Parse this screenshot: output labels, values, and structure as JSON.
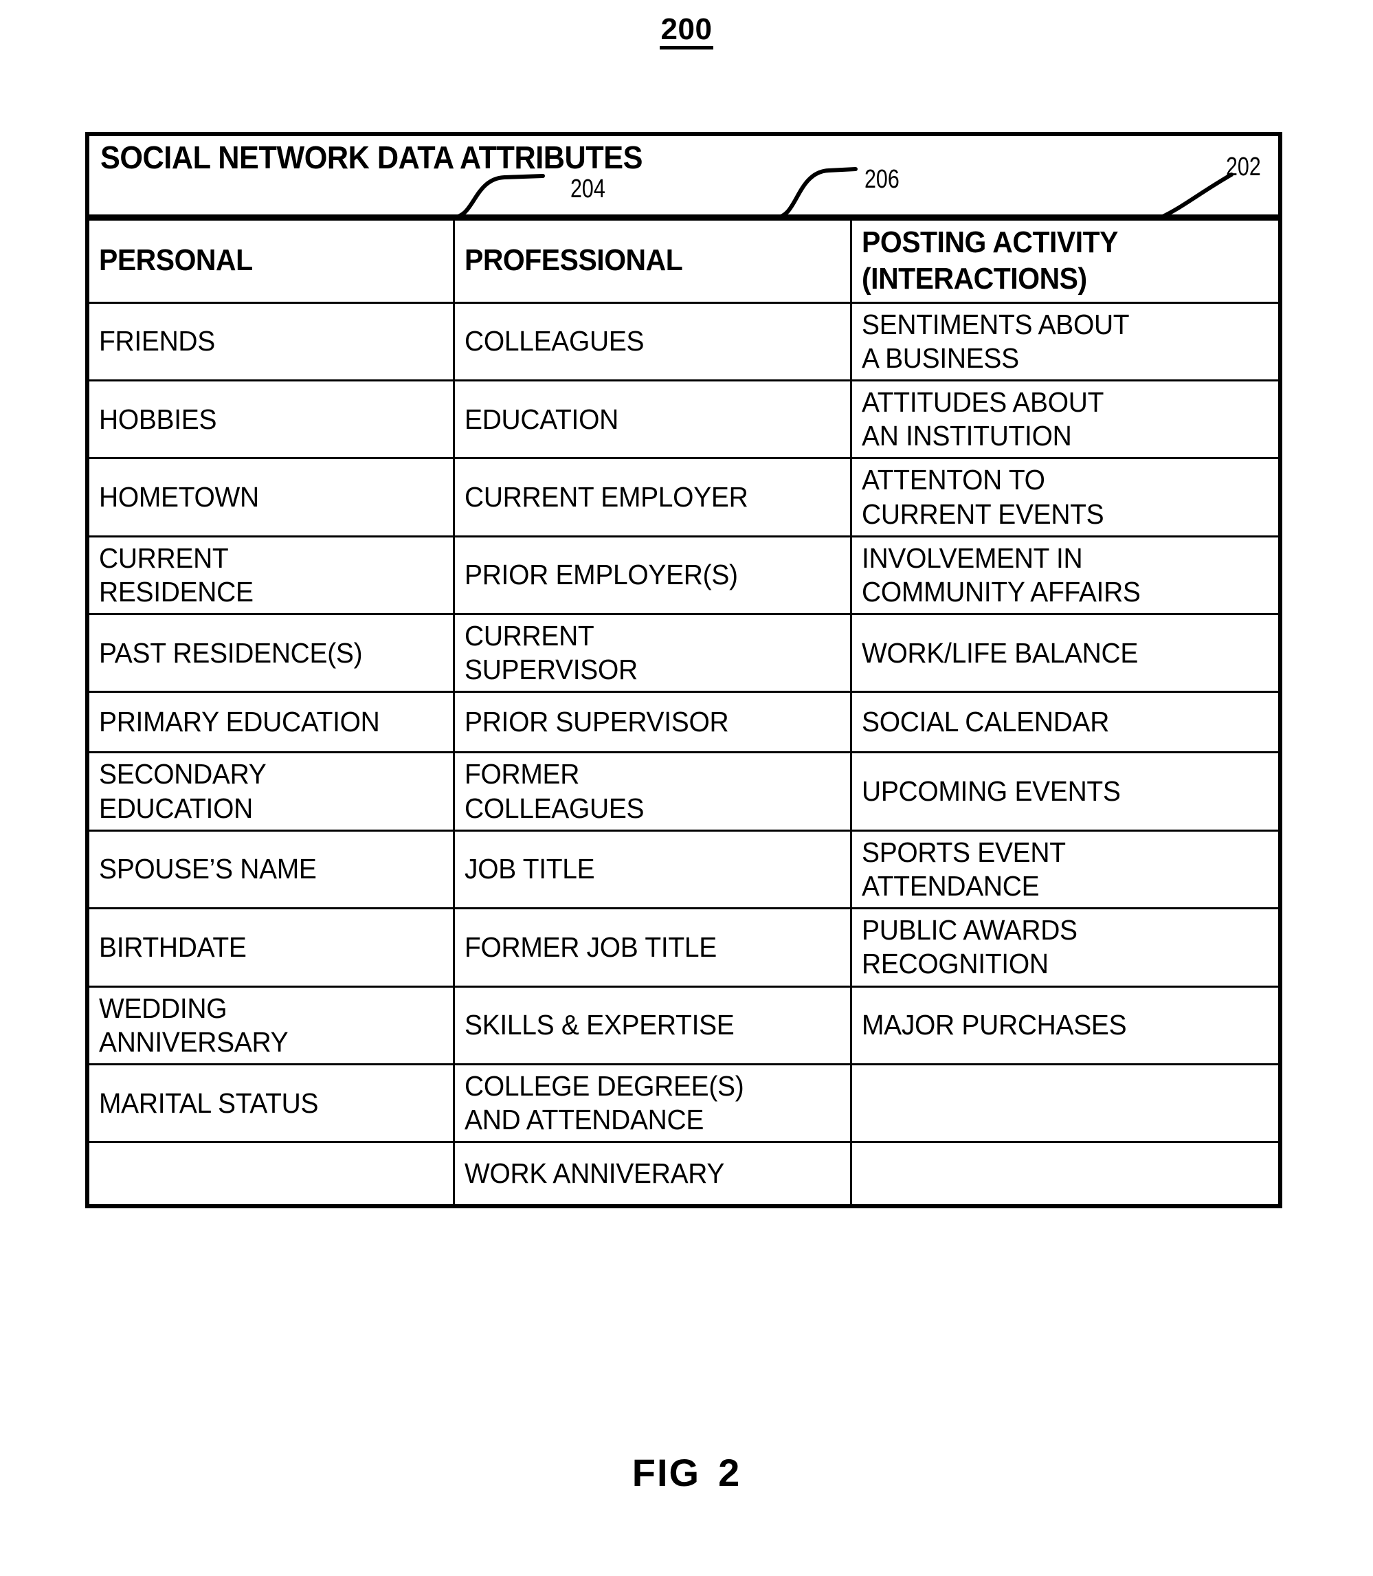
{
  "figure": {
    "top_number": "200",
    "bottom_label_prefix": "FIG",
    "bottom_label_number": "2"
  },
  "table": {
    "banner_title": "SOCIAL NETWORK DATA ATTRIBUTES",
    "callouts": {
      "column_personal_ref": "204",
      "column_professional_ref": "206",
      "table_ref": "202"
    },
    "column_headers": [
      "PERSONAL",
      "PROFESSIONAL",
      "POSTING ACTIVITY\n(INTERACTIONS)"
    ],
    "rows": [
      {
        "personal": "FRIENDS",
        "professional": "COLLEAGUES",
        "posting_activity": "SENTIMENTS ABOUT\nA BUSINESS"
      },
      {
        "personal": "HOBBIES",
        "professional": "EDUCATION",
        "posting_activity": "ATTITUDES ABOUT\nAN INSTITUTION"
      },
      {
        "personal": "HOMETOWN",
        "professional": "CURRENT EMPLOYER",
        "posting_activity": "ATTENTON TO\nCURRENT EVENTS"
      },
      {
        "personal": "CURRENT\nRESIDENCE",
        "professional": "PRIOR EMPLOYER(S)",
        "posting_activity": " INVOLVEMENT IN\nCOMMUNITY AFFAIRS"
      },
      {
        "personal": "PAST RESIDENCE(S)",
        "professional": "CURRENT\nSUPERVISOR",
        "posting_activity": "WORK/LIFE BALANCE"
      },
      {
        "personal": "PRIMARY EDUCATION",
        "professional": "PRIOR SUPERVISOR",
        "posting_activity": "SOCIAL CALENDAR"
      },
      {
        "personal": "SECONDARY\nEDUCATION",
        "professional": "FORMER\nCOLLEAGUES",
        "posting_activity": "UPCOMING EVENTS"
      },
      {
        "personal": "SPOUSE’S NAME",
        "professional": "JOB TITLE",
        "posting_activity": "SPORTS EVENT\nATTENDANCE"
      },
      {
        "personal": "BIRTHDATE",
        "professional": "FORMER JOB TITLE",
        "posting_activity": "PUBLIC AWARDS\nRECOGNITION"
      },
      {
        "personal": "WEDDING\nANNIVERSARY",
        "professional": "SKILLS & EXPERTISE",
        "posting_activity": "MAJOR PURCHASES"
      },
      {
        "personal": "MARITAL STATUS",
        "professional": "COLLEGE DEGREE(S)\nAND ATTENDANCE",
        "posting_activity": ""
      },
      {
        "personal": "",
        "professional": "WORK ANNIVERARY",
        "posting_activity": ""
      }
    ]
  },
  "colors": {
    "ink": "#000000",
    "paper": "#ffffff"
  }
}
